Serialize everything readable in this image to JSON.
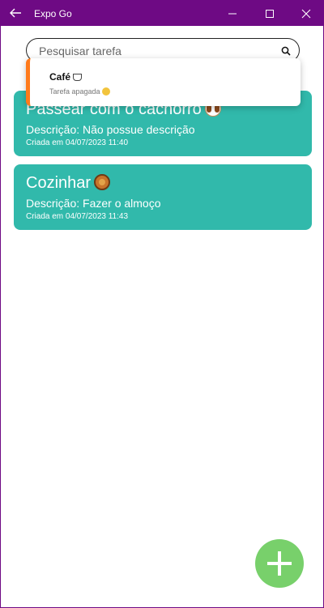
{
  "window": {
    "title": "Expo Go"
  },
  "search": {
    "placeholder": "Pesquisar tarefa",
    "value": ""
  },
  "toast": {
    "title": "Café",
    "message": "Tarefa apagada"
  },
  "tasks": [
    {
      "title": "Passear com o cachorro",
      "description": "Descrição: Não possue descrição",
      "created": "Criada em 04/07/2023 11:40",
      "emoji": "dog-face-icon"
    },
    {
      "title": "Cozinhar",
      "description": "Descrição: Fazer o almoço",
      "created": "Criada em 04/07/2023 11:43",
      "emoji": "paella-icon"
    }
  ],
  "colors": {
    "titlebar": "#6e0a84",
    "card": "#31b9ab",
    "fab": "#78d06b",
    "toast_accent": "#ff7a1a"
  }
}
